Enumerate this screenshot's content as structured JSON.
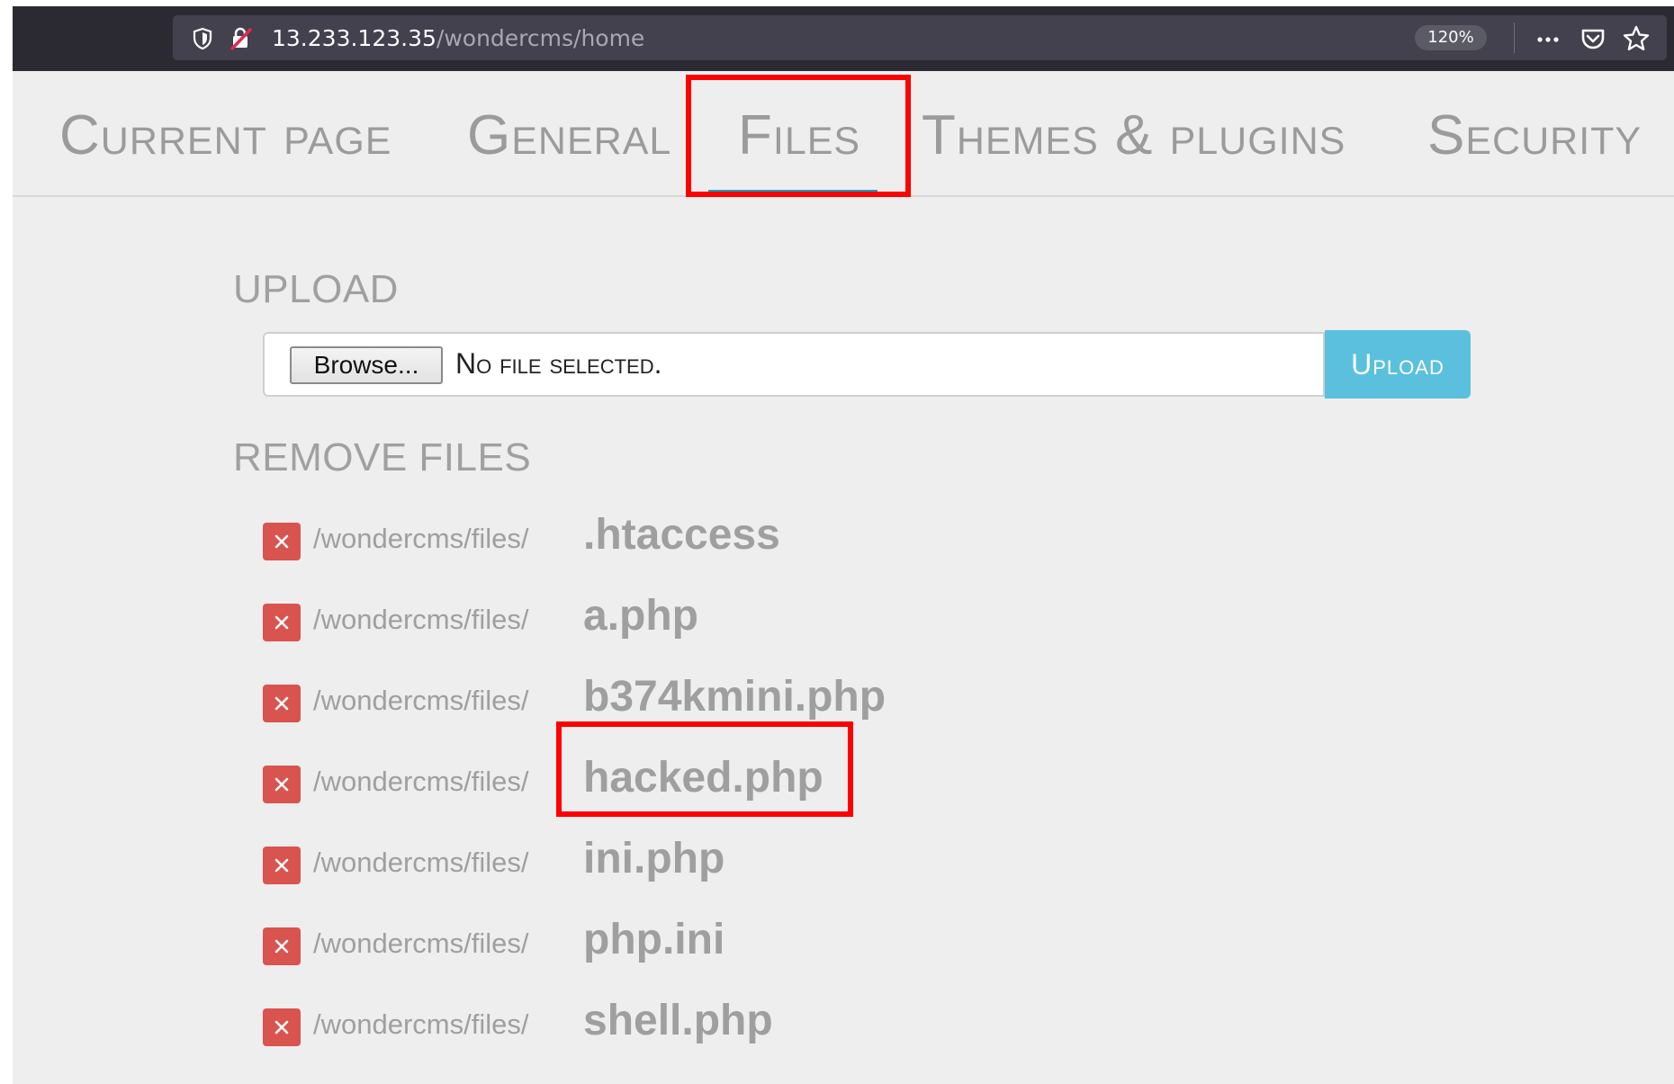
{
  "browser": {
    "url_host": "13.233.123.35",
    "url_path": "/wondercms/home",
    "zoom": "120%",
    "icons": [
      "shield-icon",
      "insecure-connection-icon",
      "more-options-icon",
      "pocket-icon",
      "bookmark-star-icon"
    ]
  },
  "nav": {
    "tabs": [
      {
        "label": "Current page"
      },
      {
        "label": "General"
      },
      {
        "label": "Files",
        "active": true
      },
      {
        "label": "Themes & plugins"
      },
      {
        "label": "Security"
      }
    ]
  },
  "upload": {
    "heading": "UPLOAD",
    "browse_label": "Browse...",
    "file_status": "No file selected.",
    "upload_label": "Upload"
  },
  "remove": {
    "heading": "REMOVE FILES",
    "path_prefix": "/wondercms/files/",
    "files": [
      {
        "name": ".htaccess"
      },
      {
        "name": "a.php"
      },
      {
        "name": "b374kmini.php"
      },
      {
        "name": "hacked.php",
        "highlighted": true
      },
      {
        "name": "ini.php"
      },
      {
        "name": "php.ini"
      },
      {
        "name": "shell.php"
      }
    ]
  },
  "colors": {
    "accent": "#11a0bd",
    "upload_button": "#5bc0de",
    "delete_button": "#d9534f",
    "highlight": "#ff0000"
  }
}
